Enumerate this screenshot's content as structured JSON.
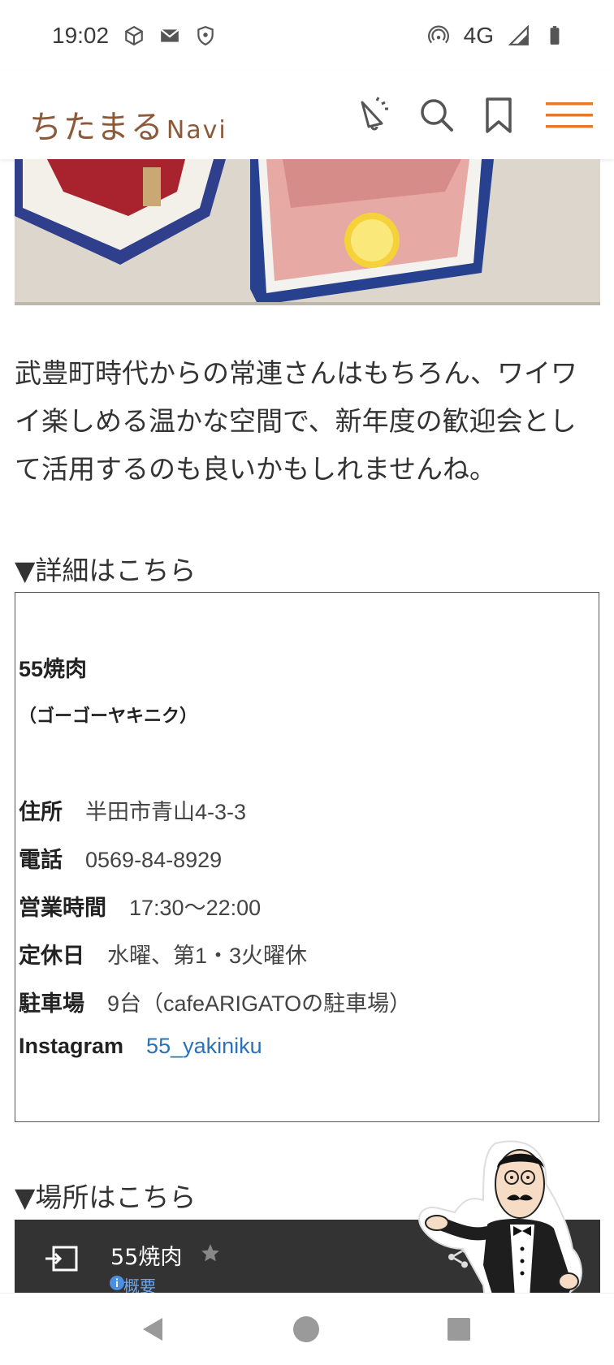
{
  "status_bar": {
    "time": "19:02",
    "network": "4G",
    "icons": [
      "cube-icon",
      "mail-icon",
      "shield-icon",
      "hotspot-icon",
      "signal-icon",
      "battery-icon"
    ]
  },
  "header": {
    "logo_text": "ちたまる",
    "logo_suffix": "Navi",
    "icons": [
      "megaphone-icon",
      "search-icon",
      "bookmark-icon",
      "menu-icon"
    ],
    "accent_color": "#e8782a",
    "logo_color": "#8a5a3b"
  },
  "article": {
    "paragraph_lines": [
      "武豊町時代からの常連さんはもちろん、ワイワ",
      "イ楽しめる温かな空間で、新年度の歓迎会とし",
      "て活用するのも良いかもしれませんね。"
    ],
    "detail_heading": "▼詳細はこちら",
    "location_heading": "▼場所はこちら"
  },
  "shop": {
    "name": "55焼肉",
    "kana": "（ゴーゴーヤキニク）",
    "rows": [
      {
        "label": "住所",
        "value": "半田市青山4-3-3"
      },
      {
        "label": "電話",
        "value": "0569-84-8929"
      },
      {
        "label": "営業時間",
        "value": "17:30〜22:00"
      },
      {
        "label": "定休日",
        "value": "水曜、第1・3火曜休"
      },
      {
        "label": "駐車場",
        "value": "9台（cafeARIGATOの駐車場）"
      },
      {
        "label": "Instagram",
        "value": "55_yakiniku"
      }
    ],
    "link_color": "#2a72b8"
  },
  "map": {
    "title": "55焼肉",
    "subtitle": "概要"
  },
  "nav": {
    "icons": [
      "back-icon",
      "home-icon",
      "recents-icon"
    ]
  }
}
